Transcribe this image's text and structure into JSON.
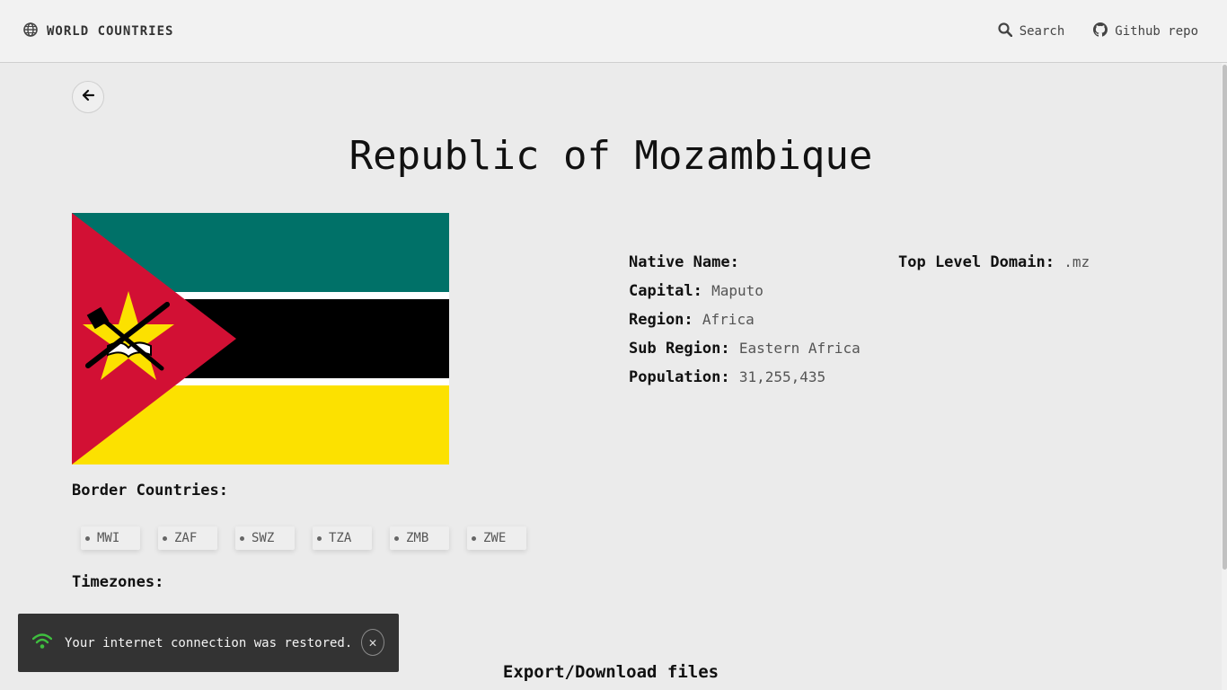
{
  "header": {
    "brand": "WORLD COUNTRIES",
    "brand_icon": "globe-icon",
    "nav": {
      "search_label": "Search",
      "search_icon": "search-icon",
      "github_label": "Github repo",
      "github_icon": "github-icon"
    }
  },
  "back_icon": "arrow-left-icon",
  "country": {
    "title": "Republic of Mozambique",
    "flag_colors": {
      "green": "#007168",
      "black": "#000000",
      "yellow": "#FCE100",
      "red": "#D21034",
      "white": "#FFFFFF"
    },
    "details": {
      "native_name_label": "Native Name:",
      "native_name": "",
      "capital_label": "Capital:",
      "capital": "Maputo",
      "region_label": "Region:",
      "region": "Africa",
      "subregion_label": "Sub Region:",
      "subregion": "Eastern Africa",
      "population_label": "Population:",
      "population": "31,255,435",
      "tld_label": "Top Level Domain:",
      "tld": ".mz"
    },
    "border_countries_label": "Border Countries:",
    "border_countries": [
      "MWI",
      "ZAF",
      "SWZ",
      "TZA",
      "ZMB",
      "ZWE"
    ],
    "timezones_label": "Timezones:"
  },
  "export_label": "Export/Download files",
  "toast": {
    "icon": "wifi-icon",
    "message": "Your internet connection was restored.",
    "close_symbol": "✕"
  }
}
